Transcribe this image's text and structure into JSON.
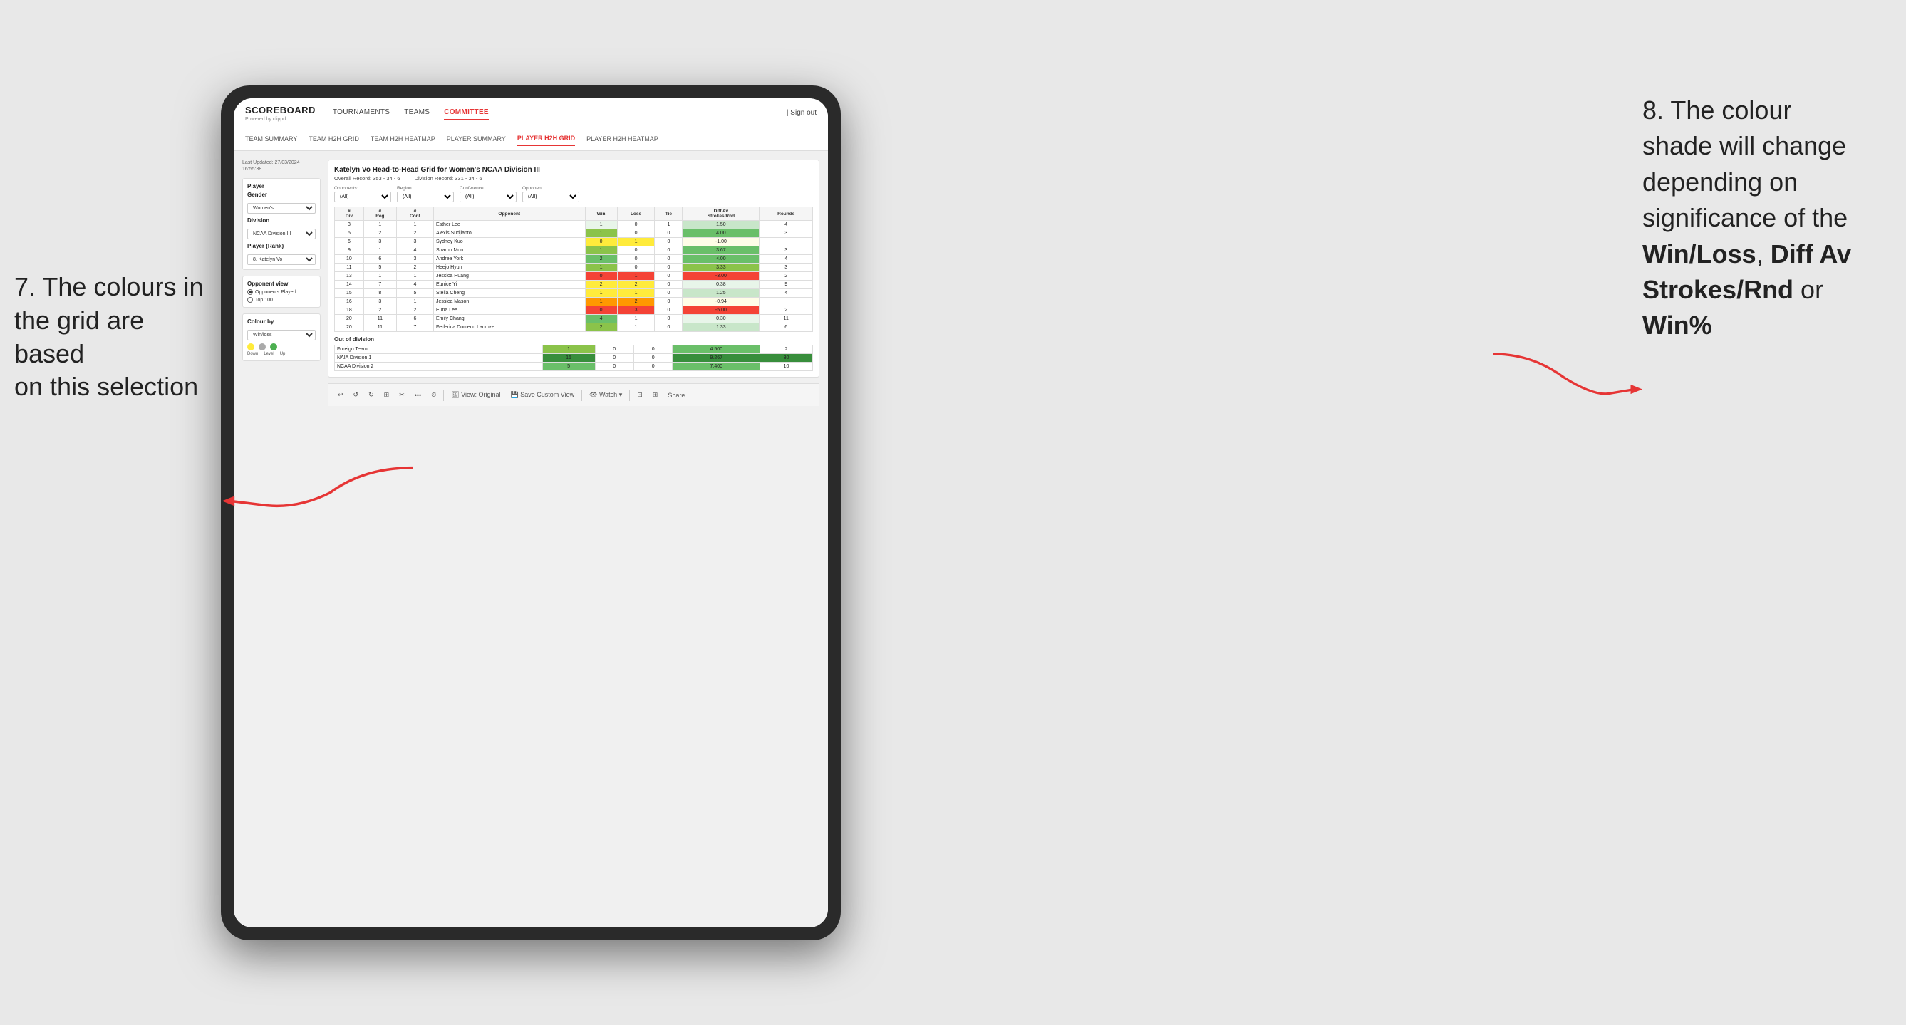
{
  "page": {
    "background": "#e8e8e8"
  },
  "annotation_left": {
    "line1": "7. The colours in",
    "line2": "the grid are based",
    "line3": "on this selection"
  },
  "annotation_right": {
    "line1": "8. The colour",
    "line2": "shade will change",
    "line3": "depending on",
    "line4": "significance of the",
    "bold1": "Win/Loss",
    "comma1": ", ",
    "bold2": "Diff Av",
    "newline": "",
    "bold3": "Strokes/Rnd",
    "line5": " or",
    "bold4": "Win%"
  },
  "nav": {
    "logo": "SCOREBOARD",
    "logo_sub": "Powered by clippd",
    "items": [
      "TOURNAMENTS",
      "TEAMS",
      "COMMITTEE"
    ],
    "active": "COMMITTEE",
    "right": [
      "| Sign out"
    ]
  },
  "sub_nav": {
    "items": [
      "TEAM SUMMARY",
      "TEAM H2H GRID",
      "TEAM H2H HEATMAP",
      "PLAYER SUMMARY",
      "PLAYER H2H GRID",
      "PLAYER H2H HEATMAP"
    ],
    "active": "PLAYER H2H GRID"
  },
  "sidebar": {
    "last_updated_label": "Last Updated: 27/03/2024",
    "last_updated_time": "16:55:38",
    "player_section": "Player",
    "gender_label": "Gender",
    "gender_value": "Women's",
    "division_label": "Division",
    "division_value": "NCAA Division III",
    "player_rank_label": "Player (Rank)",
    "player_rank_value": "8. Katelyn Vo",
    "opponent_view_label": "Opponent view",
    "radio1": "Opponents Played",
    "radio2": "Top 100",
    "colour_by_label": "Colour by",
    "colour_by_value": "Win/loss",
    "legend": {
      "down": "Down",
      "level": "Level",
      "up": "Up"
    }
  },
  "main": {
    "title": "Katelyn Vo Head-to-Head Grid for Women's NCAA Division III",
    "overall_record_label": "Overall Record:",
    "overall_record": "353 - 34 - 6",
    "division_record_label": "Division Record:",
    "division_record": "331 - 34 - 6",
    "filters": {
      "opponents_label": "Opponents:",
      "opponents_value": "(All)",
      "region_label": "Region",
      "conference_label": "Conference",
      "opponent_label": "Opponent",
      "region_value": "(All)",
      "conference_value": "(All)",
      "opponent_value": "(All)"
    },
    "table_headers": [
      "#\nDiv",
      "#\nReg",
      "#\nConf",
      "Opponent",
      "Win",
      "Loss",
      "Tie",
      "Diff Av\nStrokes/Rnd",
      "Rounds"
    ],
    "rows": [
      {
        "div": "3",
        "reg": "1",
        "conf": "1",
        "opponent": "Esther Lee",
        "win": "1",
        "loss": "0",
        "tie": "1",
        "diff": "1.50",
        "rounds": "4",
        "win_color": "white",
        "diff_color": "light-green"
      },
      {
        "div": "5",
        "reg": "2",
        "conf": "2",
        "opponent": "Alexis Sudjianto",
        "win": "1",
        "loss": "0",
        "tie": "0",
        "diff": "4.00",
        "rounds": "3",
        "win_color": "green-med",
        "diff_color": "bright-green"
      },
      {
        "div": "6",
        "reg": "3",
        "conf": "3",
        "opponent": "Sydney Kuo",
        "win": "0",
        "loss": "1",
        "tie": "0",
        "diff": "-1.00",
        "rounds": "",
        "win_color": "yellow",
        "diff_color": "pale-yellow"
      },
      {
        "div": "9",
        "reg": "1",
        "conf": "4",
        "opponent": "Sharon Mun",
        "win": "1",
        "loss": "0",
        "tie": "0",
        "diff": "3.67",
        "rounds": "3",
        "win_color": "green-med",
        "diff_color": "bright-green"
      },
      {
        "div": "10",
        "reg": "6",
        "conf": "3",
        "opponent": "Andrea York",
        "win": "2",
        "loss": "0",
        "tie": "0",
        "diff": "4.00",
        "rounds": "4",
        "win_color": "bright-green",
        "diff_color": "bright-green"
      },
      {
        "div": "11",
        "reg": "5",
        "conf": "2",
        "opponent": "Heejo Hyun",
        "win": "1",
        "loss": "0",
        "tie": "0",
        "diff": "3.33",
        "rounds": "3",
        "win_color": "green-med",
        "diff_color": "green-med"
      },
      {
        "div": "13",
        "reg": "1",
        "conf": "1",
        "opponent": "Jessica Huang",
        "win": "0",
        "loss": "1",
        "tie": "0",
        "diff": "-3.00",
        "rounds": "2",
        "win_color": "red",
        "diff_color": "red"
      },
      {
        "div": "14",
        "reg": "7",
        "conf": "4",
        "opponent": "Eunice Yi",
        "win": "2",
        "loss": "2",
        "tie": "0",
        "diff": "0.38",
        "rounds": "9",
        "win_color": "yellow",
        "diff_color": "very-light-green"
      },
      {
        "div": "15",
        "reg": "8",
        "conf": "5",
        "opponent": "Stella Cheng",
        "win": "1",
        "loss": "1",
        "tie": "0",
        "diff": "1.25",
        "rounds": "4",
        "win_color": "yellow",
        "diff_color": "light-green"
      },
      {
        "div": "16",
        "reg": "3",
        "conf": "1",
        "opponent": "Jessica Mason",
        "win": "1",
        "loss": "2",
        "tie": "0",
        "diff": "-0.94",
        "rounds": "",
        "win_color": "orange",
        "diff_color": "pale-yellow"
      },
      {
        "div": "18",
        "reg": "2",
        "conf": "2",
        "opponent": "Euna Lee",
        "win": "0",
        "loss": "3",
        "tie": "0",
        "diff": "-5.00",
        "rounds": "2",
        "win_color": "red",
        "diff_color": "red"
      },
      {
        "div": "20",
        "reg": "11",
        "conf": "6",
        "opponent": "Emily Chang",
        "win": "4",
        "loss": "1",
        "tie": "0",
        "diff": "0.30",
        "rounds": "11",
        "win_color": "bright-green",
        "diff_color": "very-light-green"
      },
      {
        "div": "20",
        "reg": "11",
        "conf": "7",
        "opponent": "Federica Domecq Lacroze",
        "win": "2",
        "loss": "1",
        "tie": "0",
        "diff": "1.33",
        "rounds": "6",
        "win_color": "green-med",
        "diff_color": "light-green"
      }
    ],
    "out_of_division_label": "Out of division",
    "out_rows": [
      {
        "opponent": "Foreign Team",
        "win": "1",
        "loss": "0",
        "tie": "0",
        "diff": "4.500",
        "rounds": "2",
        "win_color": "green-med",
        "diff_color": "bright-green"
      },
      {
        "opponent": "NAIA Division 1",
        "win": "15",
        "loss": "0",
        "tie": "0",
        "diff": "9.267",
        "rounds": "30",
        "win_color": "deep-green",
        "diff_color": "deep-green"
      },
      {
        "opponent": "NCAA Division 2",
        "win": "5",
        "loss": "0",
        "tie": "0",
        "diff": "7.400",
        "rounds": "10",
        "win_color": "bright-green",
        "diff_color": "bright-green"
      }
    ]
  },
  "toolbar": {
    "buttons": [
      "↩",
      "↺",
      "↻",
      "⊞",
      "✂",
      "·",
      "⏱",
      "|",
      "View: Original",
      "Save Custom View",
      "|",
      "👁 Watch ▾",
      "|",
      "⊡",
      "⊞",
      "Share"
    ]
  }
}
